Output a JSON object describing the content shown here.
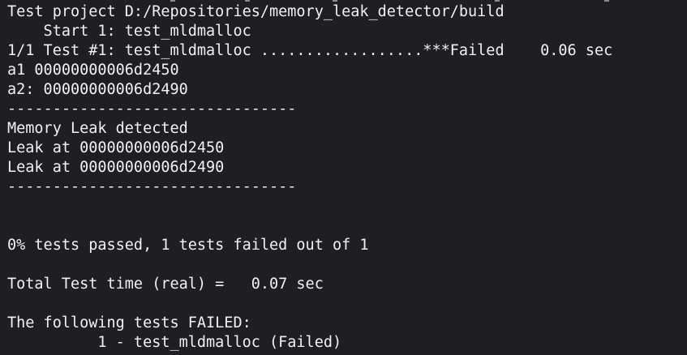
{
  "terminal": {
    "lines": [
      "Test project D:/Repositories/memory_leak_detector/build",
      "    Start 1: test_mldmalloc",
      "1/1 Test #1: test_mldmalloc ..................***Failed    0.06 sec",
      "a1 00000000006d2450",
      "a2: 00000000006d2490",
      "--------------------------------",
      "Memory Leak detected",
      "Leak at 00000000006d2450",
      "Leak at 00000000006d2490",
      "--------------------------------",
      "",
      "",
      "0% tests passed, 1 tests failed out of 1",
      "",
      "Total Test time (real) =   0.07 sec",
      "",
      "The following tests FAILED:",
      "          1 - test_mldmalloc (Failed)"
    ]
  },
  "colors": {
    "background": "#1e1e23",
    "text": "#f2f2f2"
  }
}
